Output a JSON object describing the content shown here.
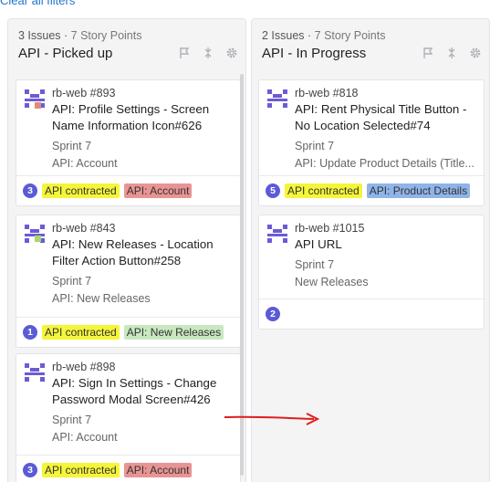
{
  "header": {
    "clear_filters": "Clear all filters"
  },
  "colors": {
    "label_yellow": "#f5f53a",
    "label_red": "#e99494",
    "label_green": "#c8e8c0",
    "label_blue": "#8fb4e8",
    "weight_badge": "#5b5bd6",
    "arrow": "#e01e1e"
  },
  "columns": [
    {
      "issues_count": "3 Issues",
      "story_points": "7 Story Points",
      "title": "API - Picked up",
      "cards": [
        {
          "ref": "rb-web #893",
          "title": "API: Profile Settings - Screen Name Information Icon#626",
          "sprint": "Sprint 7",
          "epic": "API: Account",
          "weight": "3",
          "labels": [
            {
              "text": "API contracted",
              "color": "#f5f53a"
            },
            {
              "text": "API: Account",
              "color": "#e99494"
            }
          ]
        },
        {
          "ref": "rb-web #843",
          "title": "API: New Releases - Location Filter Action Button#258",
          "sprint": "Sprint 7",
          "epic": "API: New Releases",
          "weight": "1",
          "labels": [
            {
              "text": "API contracted",
              "color": "#f5f53a"
            },
            {
              "text": "API: New Releases",
              "color": "#c8e8c0"
            }
          ]
        },
        {
          "ref": "rb-web #898",
          "title": "API: Sign In Settings - Change Password Modal Screen#426",
          "sprint": "Sprint 7",
          "epic": "API: Account",
          "weight": "3",
          "labels": [
            {
              "text": "API contracted",
              "color": "#f5f53a"
            },
            {
              "text": "API: Account",
              "color": "#e99494"
            }
          ]
        }
      ]
    },
    {
      "issues_count": "2 Issues",
      "story_points": "7 Story Points",
      "title": "API - In Progress",
      "cards": [
        {
          "ref": "rb-web #818",
          "title": "API: Rent Physical Title Button - No Location Selected#74",
          "sprint": "Sprint 7",
          "epic": "API: Update Product Details (Title...",
          "weight": "5",
          "labels": [
            {
              "text": "API contracted",
              "color": "#f5f53a"
            },
            {
              "text": "API: Product Details",
              "color": "#8fb4e8"
            }
          ]
        },
        {
          "ref": "rb-web #1015",
          "title": "API URL",
          "sprint": "Sprint 7",
          "epic": "New Releases",
          "weight": "2",
          "labels": []
        }
      ]
    }
  ]
}
